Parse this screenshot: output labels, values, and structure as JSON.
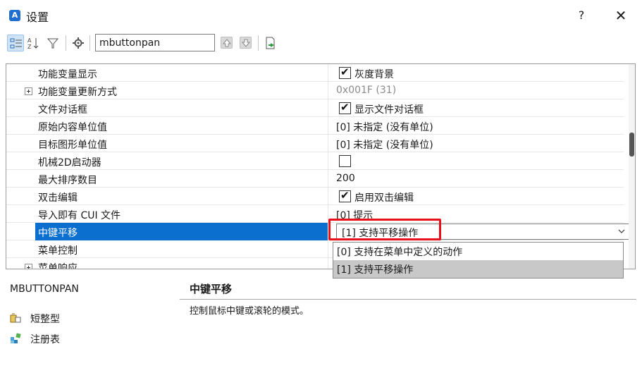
{
  "window": {
    "title": "设置",
    "help_label": "?",
    "close_label": "✕",
    "app_icon_letter": "A"
  },
  "toolbar": {
    "search_value": "mbuttonpan",
    "buttons": [
      "categorized-view-icon",
      "alphabetical-sort-icon",
      "filter-icon",
      "settings-gear-icon",
      "move-up-icon",
      "move-down-icon",
      "export-icon"
    ]
  },
  "properties": [
    {
      "label": "功能变量显示",
      "type": "checkbox",
      "checked": true,
      "value": "灰度背景"
    },
    {
      "label": "功能变量更新方式",
      "type": "text",
      "expandable": true,
      "disabled": true,
      "value": "0x001F (31)"
    },
    {
      "label": "文件对话框",
      "type": "checkbox",
      "checked": true,
      "value": "显示文件对话框"
    },
    {
      "label": "原始内容单位值",
      "type": "text",
      "value": "[0] 未指定 (没有单位)"
    },
    {
      "label": "目标图形单位值",
      "type": "text",
      "value": "[0] 未指定 (没有单位)"
    },
    {
      "label": "机械2D启动器",
      "type": "checkbox",
      "checked": false,
      "value": ""
    },
    {
      "label": "最大排序数目",
      "type": "text",
      "value": "200"
    },
    {
      "label": "双击编辑",
      "type": "checkbox",
      "checked": true,
      "value": "启用双击编辑"
    },
    {
      "label": "导入即有 CUI 文件",
      "type": "text",
      "value": "[0] 提示"
    },
    {
      "label": "中键平移",
      "type": "combo",
      "selected": true,
      "value": "[1] 支持平移操作"
    },
    {
      "label": "菜单控制",
      "type": "text",
      "value": ""
    },
    {
      "label": "菜单响应",
      "type": "text",
      "expandable": true,
      "value": ""
    }
  ],
  "dropdown": {
    "options": [
      "[0] 支持在菜单中定义的动作",
      "[1] 支持平移操作"
    ],
    "hover_index": 1
  },
  "info": {
    "variable_name": "MBUTTONPAN",
    "title": "中键平移",
    "description": "控制鼠标中键或滚轮的模式。",
    "type_label": "短整型",
    "storage_label": "注册表"
  },
  "colors": {
    "selection": "#0b6fd0",
    "highlight_box": "#e8101a",
    "hover": "#c8c8c8"
  }
}
